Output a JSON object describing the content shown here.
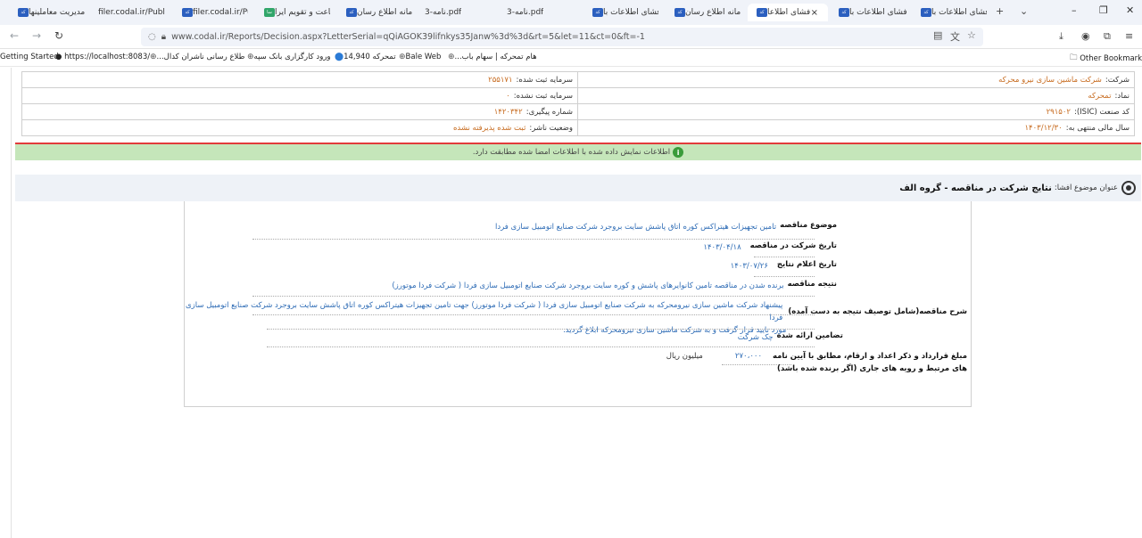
{
  "browser": {
    "tabs": [
      {
        "title": "افشای اطلاعات با",
        "fav": "کدال"
      },
      {
        "title": "افشای اطلاعات با",
        "fav": "کدال"
      },
      {
        "title": "افشای اطلاعا",
        "fav": "کدال",
        "active": true,
        "close": "×"
      },
      {
        "title": "سامانه اطلاع رسان",
        "fav": "کدال"
      },
      {
        "title": "افشای اطلاعات با",
        "fav": "کدال"
      },
      {
        "title": "نامه-3.pdf",
        "fav": ""
      },
      {
        "title": "نامه-3.pdf",
        "fav": ""
      },
      {
        "title": "سامانه اطلاع رسان",
        "fav": "کدال"
      },
      {
        "title": "ساعت و تقویم ایرا",
        "fav": "ساعت"
      },
      {
        "title": "filer.codal.ir/Publ",
        "fav": "کدال"
      },
      {
        "title": "filer.codal.ir/Publ",
        "fav": "کدال"
      },
      {
        "title": "مدیریت معاملینها",
        "fav": "کدال"
      }
    ],
    "new_tab": "+",
    "tab_list": "⌄",
    "window_controls": {
      "minimize": "–",
      "restore": "❐",
      "close": "✕"
    },
    "nav": {
      "back": "←",
      "forward": "→",
      "reload": "↻"
    },
    "url": "www.codal.ir/Reports/Decision.aspx?LetterSerial=qQiAGOK39lifnkys35Janw%3d%3d&rt=5&let=11&ct=0&ft=-1",
    "bookmarks": [
      {
        "label": "Getting Started"
      },
      {
        "label": "https://localhost:8083/"
      },
      {
        "label": "...طلاع رسانی ناشران کدال"
      },
      {
        "label": "ورود کارگزاری بانک سپه"
      },
      {
        "label": "تمحرکه 14,940"
      },
      {
        "label": "Bale Web"
      },
      {
        "label": "...هام تمحرکه | سهام باب"
      }
    ],
    "other_bookmarks": "Other Bookmarks"
  },
  "company_info": {
    "company_label": "شرکت:",
    "company_value": "شرکت ماشین سازی نیرو محرکه",
    "symbol_label": "نماد:",
    "symbol_value": "تمحرکه",
    "isic_label": "کد صنعت (ISIC):",
    "isic_value": "۲۹۱۵۰۲",
    "fiscal_label": "سال مالی منتهی به:",
    "fiscal_value": "۱۴۰۳/۱۲/۳۰",
    "registered_capital_label": "سرمایه ثبت شده:",
    "registered_capital_value": "۲۵۵۱۷۱",
    "unregistered_capital_label": "سرمایه ثبت نشده:",
    "unregistered_capital_value": "۰",
    "tracking_label": "شماره پیگیری:",
    "tracking_value": "۱۴۲۰۳۴۲",
    "publisher_status_label": "وضعیت ناشر:",
    "publisher_status_value": "ثبت شده پذیرفته نشده"
  },
  "notice": "اطلاعات نمایش داده شده با اطلاعات امضا شده مطابقت دارد.",
  "subject": {
    "label": "عنوان موضوع افشا:",
    "value": "نتایج شرکت در مناقصه - گروه الف"
  },
  "details": {
    "topic_label": "موضوع مناقصه",
    "topic_value": "تامین تجهیزات هیتراکس کوره اتاق پاشش سایت بروجرد شرکت صنایع اتومبیل سازی فردا",
    "participation_date_label": "تاریخ شرکت در مناقصه",
    "participation_date_value": "۱۴۰۳/۰۴/۱۸",
    "announce_date_label": "تاریخ اعلام نتایج",
    "announce_date_value": "۱۴۰۳/۰۷/۲۶",
    "result_label": "نتیجه مناقصه",
    "result_value": "برنده شدن در مناقصه تامین کانوایرهای پاشش و کوره سایت بروجرد شرکت صنایع اتومبیل سازی فردا ( شرکت فردا موتورز)",
    "description_label": "شرح مناقصه(شامل توصیف نتیجه به دست آمده)",
    "description_line1": "پیشنهاد شرکت ماشین سازی نیرومحرکه به شرکت صنایع اتومبیل سازی فردا ( شرکت فردا موتورز) جهت تامین تجهیزات هیتراکس کوره اتاق پاشش سایت بروجرد شرکت صنایع اتومبیل سازی فردا",
    "description_line2": "مورد تایید قرار گرفت و به شرکت ماشین سازی نیرومحرکه ابلاغ گردید.",
    "guarantee_label": "تضامین ارائه شده",
    "guarantee_value": "چک شرکت",
    "amount_label_line1": "مبلغ قرارداد و ذکر اعداد و ارقام، مطابق با آیین نامه",
    "amount_label_line2": "های مرتبط و رویه های جاری (اگر برنده شده باشد)",
    "amount_value": "۲۷۰،۰۰۰",
    "amount_unit": "میلیون ریال"
  }
}
